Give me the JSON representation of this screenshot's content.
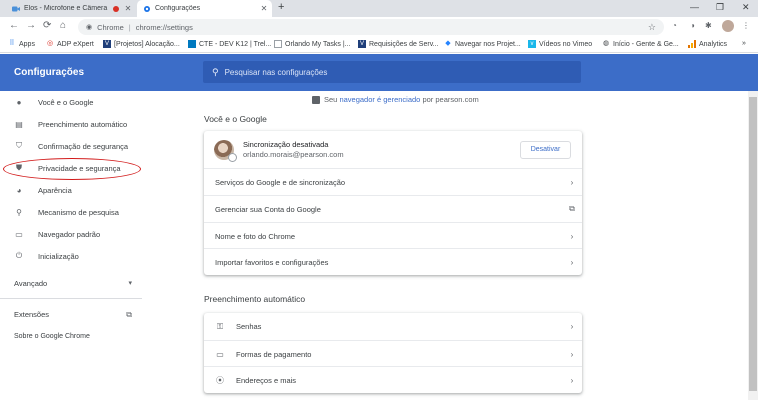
{
  "browser": {
    "tabs": [
      {
        "title": "Elos - Microfone e Câmera",
        "active": false,
        "recording": true
      },
      {
        "title": "Configurações",
        "active": true
      }
    ],
    "new_tab": "+",
    "window_controls": {
      "minimize": "—",
      "maximize": "❐",
      "close": "✕"
    },
    "omnibox": {
      "scheme": "Chrome",
      "url": "chrome://settings"
    },
    "bookmarks": [
      {
        "label": "Apps",
        "icon": "apps-grid-icon"
      },
      {
        "label": "ADP eXpert",
        "icon": "adp-icon"
      },
      {
        "label": "[Projetos] Alocação...",
        "icon": "bookmark-v-icon"
      },
      {
        "label": "CTE - DEV K12 | Trel...",
        "icon": "trello-icon"
      },
      {
        "label": "Orlando My Tasks |...",
        "icon": "page-icon"
      },
      {
        "label": "Requisições de Serv...",
        "icon": "bookmark-v-icon"
      },
      {
        "label": "Navegar nos Projet...",
        "icon": "diamond-icon"
      },
      {
        "label": "Vídeos no Vimeo",
        "icon": "vimeo-icon"
      },
      {
        "label": "Início - Gente & Ge...",
        "icon": "globe-icon"
      },
      {
        "label": "Analytics",
        "icon": "analytics-icon"
      }
    ],
    "bookmarks_more": "»"
  },
  "settings": {
    "header_title": "Configurações",
    "search_placeholder": "Pesquisar nas configurações",
    "sidebar": {
      "items": [
        {
          "label": "Você e o Google",
          "icon": "person-icon"
        },
        {
          "label": "Preenchimento automático",
          "icon": "clipboard-icon"
        },
        {
          "label": "Confirmação de segurança",
          "icon": "shield-check-icon"
        },
        {
          "label": "Privacidade e segurança",
          "icon": "shield-icon"
        },
        {
          "label": "Aparência",
          "icon": "palette-icon"
        },
        {
          "label": "Mecanismo de pesquisa",
          "icon": "search-icon"
        },
        {
          "label": "Navegador padrão",
          "icon": "browser-window-icon"
        },
        {
          "label": "Inicialização",
          "icon": "power-icon"
        }
      ],
      "advanced": "Avançado",
      "extensions": "Extensões",
      "about": "Sobre o Google Chrome"
    },
    "managed_banner": {
      "prefix": "Seu",
      "link": "navegador é gerenciado",
      "suffix": "por pearson.com"
    },
    "you_and_google": {
      "title": "Você e o Google",
      "sync_title": "Sincronização desativada",
      "sync_email": "orlando.morais@pearson.com",
      "disable_button": "Desativar",
      "rows": [
        "Serviços do Google e de sincronização",
        "Gerenciar sua Conta do Google",
        "Nome e foto do Chrome",
        "Importar favoritos e configurações"
      ]
    },
    "autofill": {
      "title": "Preenchimento automático",
      "rows": [
        {
          "label": "Senhas",
          "icon": "key-icon"
        },
        {
          "label": "Formas de pagamento",
          "icon": "credit-card-icon"
        },
        {
          "label": "Endereços e mais",
          "icon": "location-pin-icon"
        }
      ]
    }
  }
}
